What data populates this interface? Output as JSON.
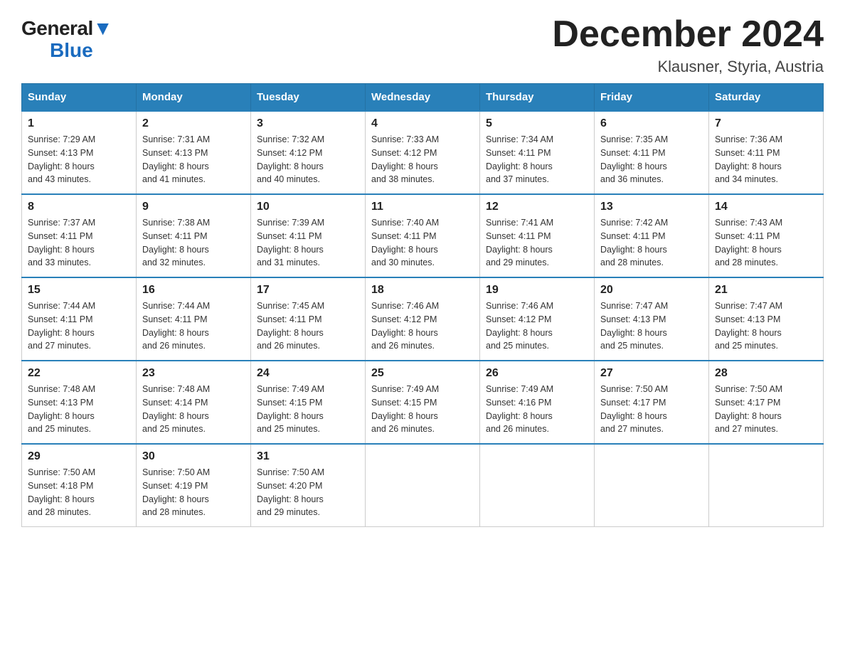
{
  "logo": {
    "general": "General",
    "blue": "Blue",
    "triangle_aria": "triangle logo"
  },
  "title": "December 2024",
  "subtitle": "Klausner, Styria, Austria",
  "days_of_week": [
    "Sunday",
    "Monday",
    "Tuesday",
    "Wednesday",
    "Thursday",
    "Friday",
    "Saturday"
  ],
  "weeks": [
    [
      {
        "day": "1",
        "sunrise": "7:29 AM",
        "sunset": "4:13 PM",
        "daylight": "8 hours and 43 minutes."
      },
      {
        "day": "2",
        "sunrise": "7:31 AM",
        "sunset": "4:13 PM",
        "daylight": "8 hours and 41 minutes."
      },
      {
        "day": "3",
        "sunrise": "7:32 AM",
        "sunset": "4:12 PM",
        "daylight": "8 hours and 40 minutes."
      },
      {
        "day": "4",
        "sunrise": "7:33 AM",
        "sunset": "4:12 PM",
        "daylight": "8 hours and 38 minutes."
      },
      {
        "day": "5",
        "sunrise": "7:34 AM",
        "sunset": "4:11 PM",
        "daylight": "8 hours and 37 minutes."
      },
      {
        "day": "6",
        "sunrise": "7:35 AM",
        "sunset": "4:11 PM",
        "daylight": "8 hours and 36 minutes."
      },
      {
        "day": "7",
        "sunrise": "7:36 AM",
        "sunset": "4:11 PM",
        "daylight": "8 hours and 34 minutes."
      }
    ],
    [
      {
        "day": "8",
        "sunrise": "7:37 AM",
        "sunset": "4:11 PM",
        "daylight": "8 hours and 33 minutes."
      },
      {
        "day": "9",
        "sunrise": "7:38 AM",
        "sunset": "4:11 PM",
        "daylight": "8 hours and 32 minutes."
      },
      {
        "day": "10",
        "sunrise": "7:39 AM",
        "sunset": "4:11 PM",
        "daylight": "8 hours and 31 minutes."
      },
      {
        "day": "11",
        "sunrise": "7:40 AM",
        "sunset": "4:11 PM",
        "daylight": "8 hours and 30 minutes."
      },
      {
        "day": "12",
        "sunrise": "7:41 AM",
        "sunset": "4:11 PM",
        "daylight": "8 hours and 29 minutes."
      },
      {
        "day": "13",
        "sunrise": "7:42 AM",
        "sunset": "4:11 PM",
        "daylight": "8 hours and 28 minutes."
      },
      {
        "day": "14",
        "sunrise": "7:43 AM",
        "sunset": "4:11 PM",
        "daylight": "8 hours and 28 minutes."
      }
    ],
    [
      {
        "day": "15",
        "sunrise": "7:44 AM",
        "sunset": "4:11 PM",
        "daylight": "8 hours and 27 minutes."
      },
      {
        "day": "16",
        "sunrise": "7:44 AM",
        "sunset": "4:11 PM",
        "daylight": "8 hours and 26 minutes."
      },
      {
        "day": "17",
        "sunrise": "7:45 AM",
        "sunset": "4:11 PM",
        "daylight": "8 hours and 26 minutes."
      },
      {
        "day": "18",
        "sunrise": "7:46 AM",
        "sunset": "4:12 PM",
        "daylight": "8 hours and 26 minutes."
      },
      {
        "day": "19",
        "sunrise": "7:46 AM",
        "sunset": "4:12 PM",
        "daylight": "8 hours and 25 minutes."
      },
      {
        "day": "20",
        "sunrise": "7:47 AM",
        "sunset": "4:13 PM",
        "daylight": "8 hours and 25 minutes."
      },
      {
        "day": "21",
        "sunrise": "7:47 AM",
        "sunset": "4:13 PM",
        "daylight": "8 hours and 25 minutes."
      }
    ],
    [
      {
        "day": "22",
        "sunrise": "7:48 AM",
        "sunset": "4:13 PM",
        "daylight": "8 hours and 25 minutes."
      },
      {
        "day": "23",
        "sunrise": "7:48 AM",
        "sunset": "4:14 PM",
        "daylight": "8 hours and 25 minutes."
      },
      {
        "day": "24",
        "sunrise": "7:49 AM",
        "sunset": "4:15 PM",
        "daylight": "8 hours and 25 minutes."
      },
      {
        "day": "25",
        "sunrise": "7:49 AM",
        "sunset": "4:15 PM",
        "daylight": "8 hours and 26 minutes."
      },
      {
        "day": "26",
        "sunrise": "7:49 AM",
        "sunset": "4:16 PM",
        "daylight": "8 hours and 26 minutes."
      },
      {
        "day": "27",
        "sunrise": "7:50 AM",
        "sunset": "4:17 PM",
        "daylight": "8 hours and 27 minutes."
      },
      {
        "day": "28",
        "sunrise": "7:50 AM",
        "sunset": "4:17 PM",
        "daylight": "8 hours and 27 minutes."
      }
    ],
    [
      {
        "day": "29",
        "sunrise": "7:50 AM",
        "sunset": "4:18 PM",
        "daylight": "8 hours and 28 minutes."
      },
      {
        "day": "30",
        "sunrise": "7:50 AM",
        "sunset": "4:19 PM",
        "daylight": "8 hours and 28 minutes."
      },
      {
        "day": "31",
        "sunrise": "7:50 AM",
        "sunset": "4:20 PM",
        "daylight": "8 hours and 29 minutes."
      },
      null,
      null,
      null,
      null
    ]
  ],
  "labels": {
    "sunrise": "Sunrise:",
    "sunset": "Sunset:",
    "daylight": "Daylight:"
  }
}
